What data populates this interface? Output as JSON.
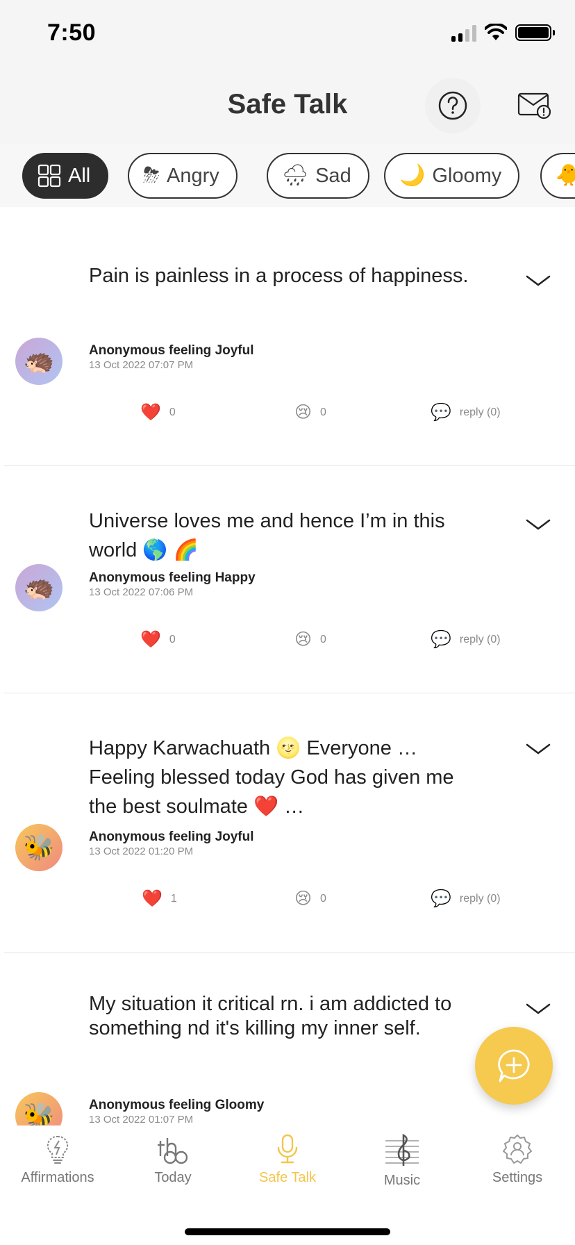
{
  "status": {
    "time": "7:50"
  },
  "header": {
    "title": "Safe Talk"
  },
  "filters": [
    {
      "label": "All",
      "icon": "grid-icon",
      "active": true
    },
    {
      "label": "Angry",
      "icon": "storm-cloud-icon",
      "emoji": "⛈"
    },
    {
      "label": "Sad",
      "icon": "rain-cloud-icon",
      "emoji": "🌧"
    },
    {
      "label": "Gloomy",
      "icon": "moon-icon",
      "emoji": "🌙"
    },
    {
      "label": "",
      "icon": "sun-icon",
      "emoji": "🐥"
    }
  ],
  "posts": [
    {
      "text": "Pain is painless in a process of happiness.",
      "author": "Anonymous feeling Joyful",
      "date": "13 Oct 2022 07:07 PM",
      "avatar_emoji": "🦔",
      "likes": "0",
      "sad": "0",
      "reply": "reply (0)"
    },
    {
      "text": "Universe loves me and hence I’m in this world 🌎 🌈",
      "author": "Anonymous feeling Happy",
      "date": "13 Oct 2022 07:06 PM",
      "avatar_emoji": "🦔",
      "likes": "0",
      "sad": "0",
      "reply": "reply (0)"
    },
    {
      "text": "Happy Karwachuath 🌝  Everyone … Feeling blessed today God has given me the best soulmate ❤️ …",
      "author": "Anonymous feeling Joyful",
      "date": "13 Oct 2022 01:20 PM",
      "avatar_emoji": "🐝",
      "likes": "1",
      "sad": "0",
      "reply": "reply (0)"
    },
    {
      "text": "My situation it critical rn. i am addicted to something nd it's killing my inner self.",
      "author": "Anonymous feeling Gloomy",
      "date": "13 Oct 2022 01:07 PM",
      "avatar_emoji": "🐝"
    }
  ],
  "reaction_icons": {
    "like": "❤️",
    "sad": "😢",
    "reply": "💬"
  },
  "tabs": [
    {
      "label": "Affirmations",
      "icon": "lightbulb-icon"
    },
    {
      "label": "Today",
      "icon": "the-logo-icon"
    },
    {
      "label": "Safe Talk",
      "icon": "microphone-icon",
      "active": true
    },
    {
      "label": "Music",
      "icon": "music-note-icon"
    },
    {
      "label": "Settings",
      "icon": "gear-icon"
    }
  ],
  "colors": {
    "accent": "#f3c54b",
    "chip_active": "#2d2d2d",
    "fab": "#f6c94f"
  }
}
